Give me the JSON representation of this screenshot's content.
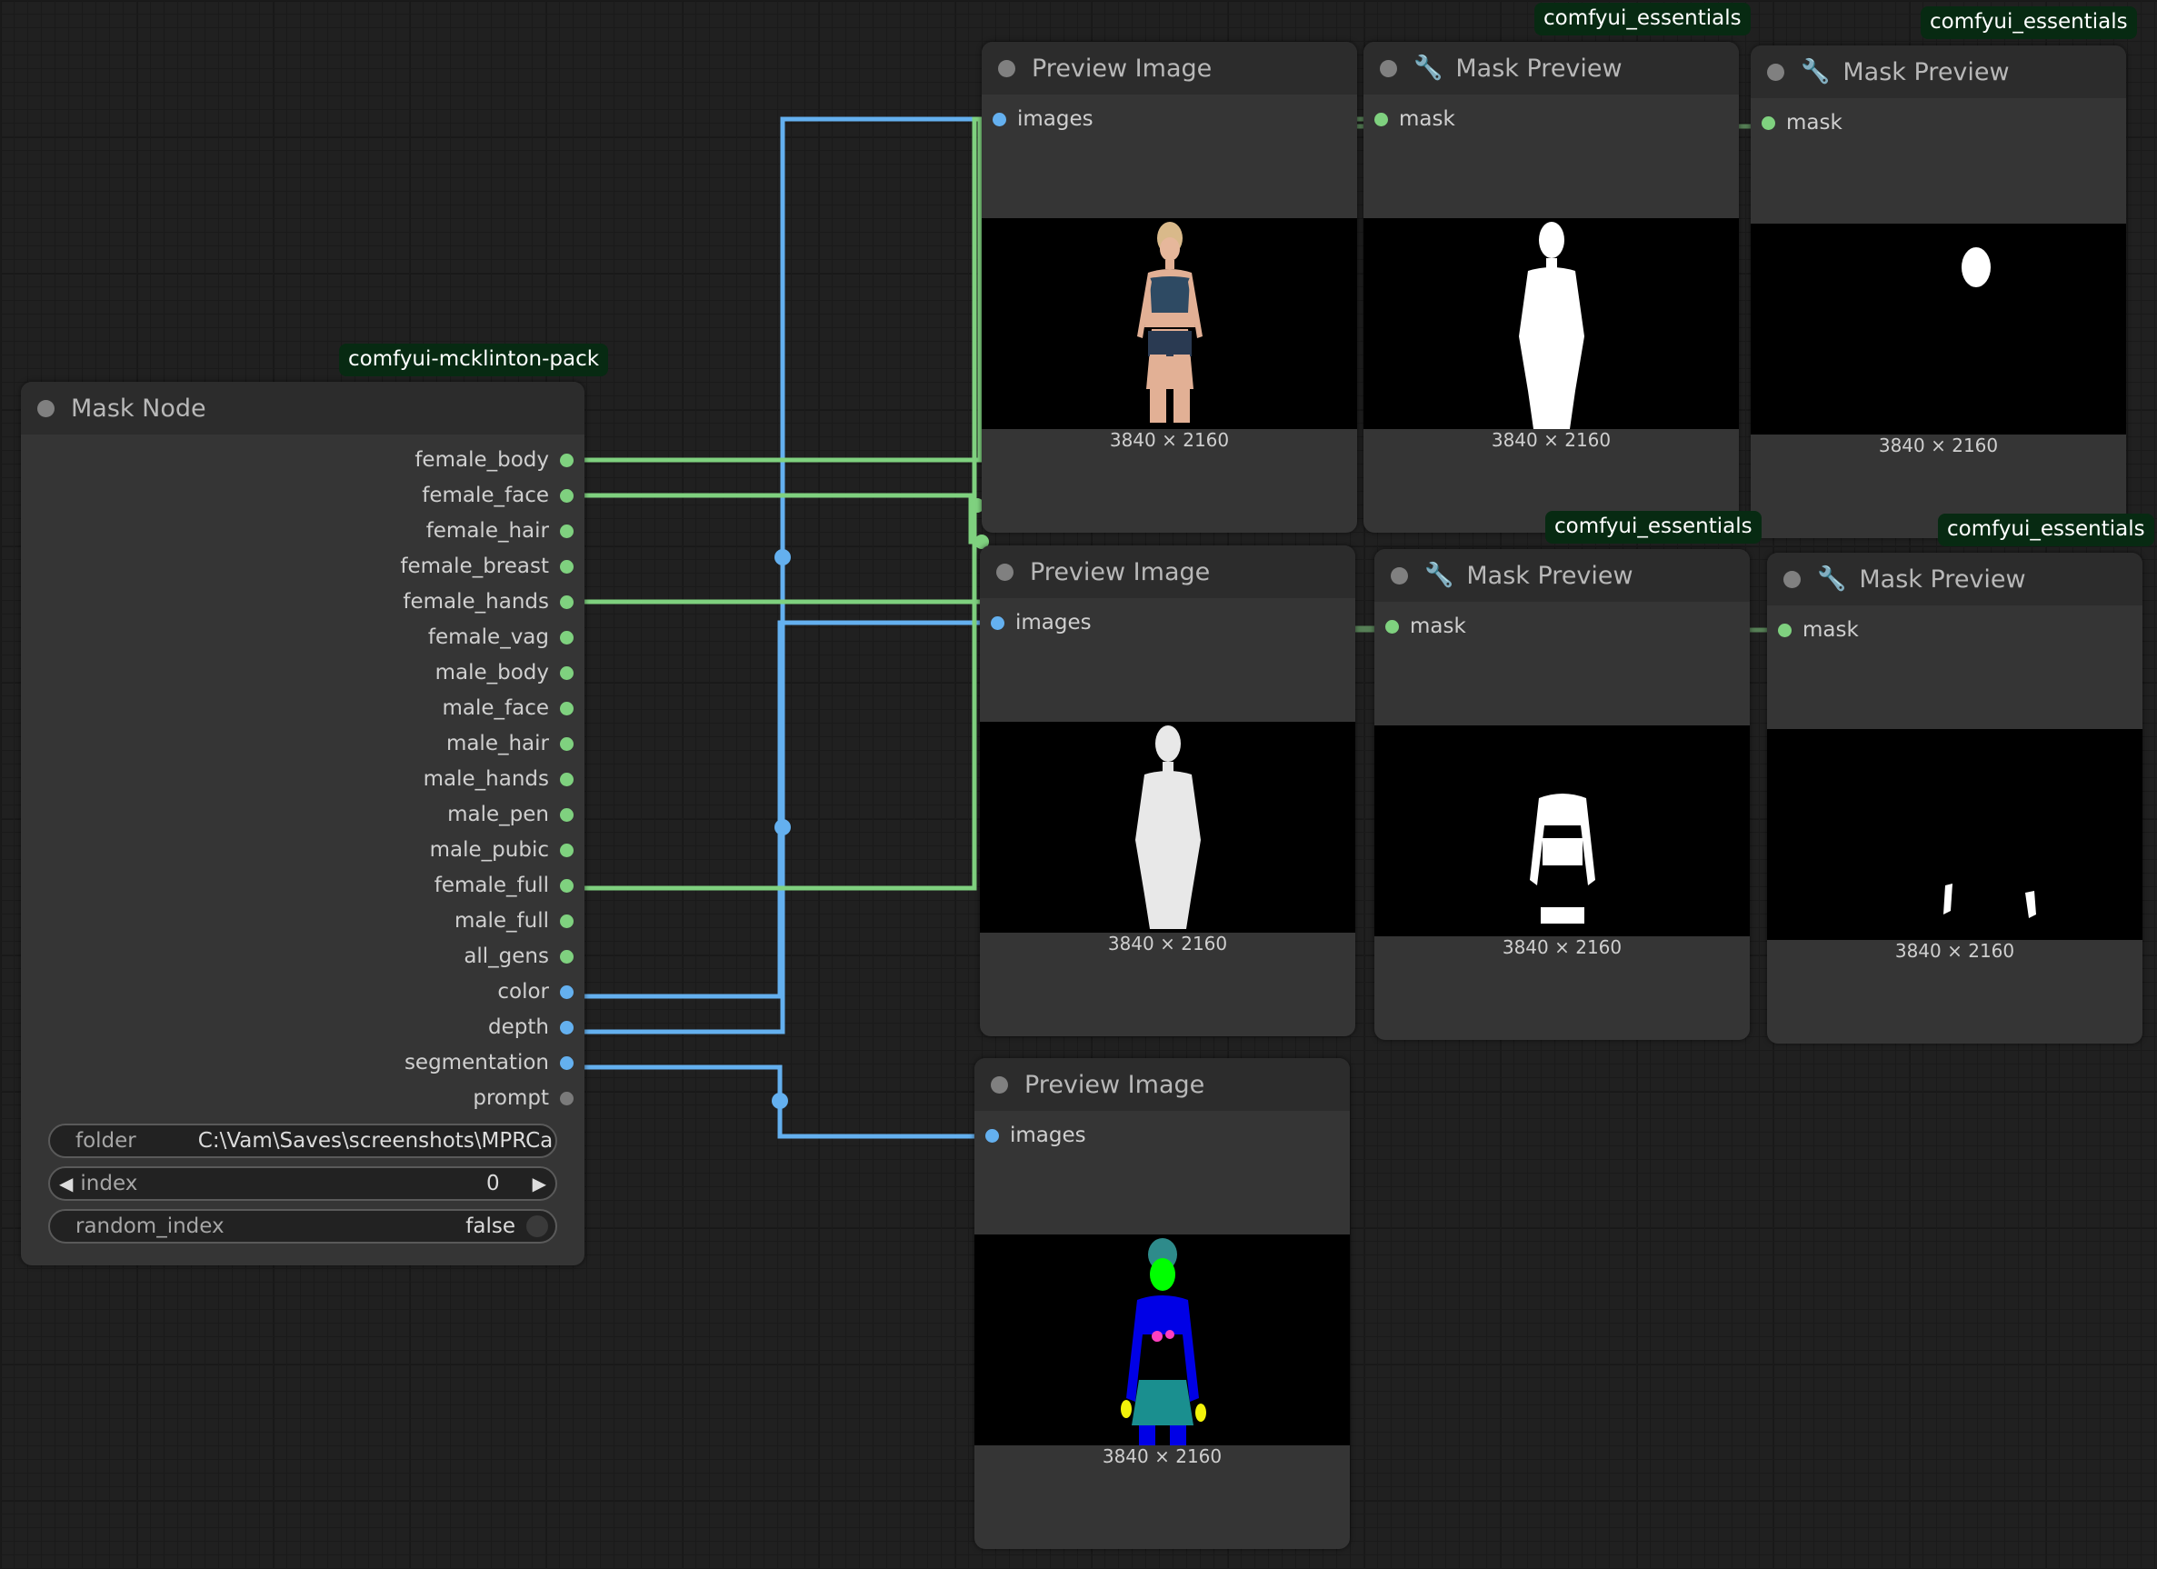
{
  "mask_node": {
    "badge": "comfyui-mcklinton-pack",
    "title": "Mask Node",
    "outputs": [
      {
        "label": "female_body",
        "type": "mask"
      },
      {
        "label": "female_face",
        "type": "mask"
      },
      {
        "label": "female_hair",
        "type": "mask"
      },
      {
        "label": "female_breast",
        "type": "mask"
      },
      {
        "label": "female_hands",
        "type": "mask"
      },
      {
        "label": "female_vag",
        "type": "mask"
      },
      {
        "label": "male_body",
        "type": "mask"
      },
      {
        "label": "male_face",
        "type": "mask"
      },
      {
        "label": "male_hair",
        "type": "mask"
      },
      {
        "label": "male_hands",
        "type": "mask"
      },
      {
        "label": "male_pen",
        "type": "mask"
      },
      {
        "label": "male_pubic",
        "type": "mask"
      },
      {
        "label": "female_full",
        "type": "mask"
      },
      {
        "label": "male_full",
        "type": "mask"
      },
      {
        "label": "all_gens",
        "type": "mask"
      },
      {
        "label": "color",
        "type": "image"
      },
      {
        "label": "depth",
        "type": "image"
      },
      {
        "label": "segmentation",
        "type": "image"
      },
      {
        "label": "prompt",
        "type": "string"
      }
    ],
    "widgets": {
      "folder_label": "folder",
      "folder_value": "C:\\Vam\\Saves\\screenshots\\MPRCa",
      "index_label": "index",
      "index_value": "0",
      "random_index_label": "random_index",
      "random_index_value": "false"
    }
  },
  "preview_nodes": [
    {
      "title": "Preview Image",
      "input": "images",
      "dims": "3840 × 2160"
    },
    {
      "title": "Preview Image",
      "input": "images",
      "dims": "3840 × 2160"
    },
    {
      "title": "Preview Image",
      "input": "images",
      "dims": "3840 × 2160"
    }
  ],
  "mask_previews": [
    {
      "badge": "comfyui_essentials",
      "title": "Mask Preview",
      "input": "mask",
      "dims": "3840 × 2160"
    },
    {
      "badge": "comfyui_essentials",
      "title": "Mask Preview",
      "input": "mask",
      "dims": "3840 × 2160"
    },
    {
      "badge": "comfyui_essentials",
      "title": "Mask Preview",
      "input": "mask",
      "dims": "3840 × 2160"
    },
    {
      "badge": "comfyui_essentials",
      "title": "Mask Preview",
      "input": "mask",
      "dims": "3840 × 2160"
    }
  ],
  "colors": {
    "mask_wire": "#7fd17f",
    "image_wire": "#64b0ef",
    "canvas": "#202020",
    "node_body": "#353535"
  }
}
